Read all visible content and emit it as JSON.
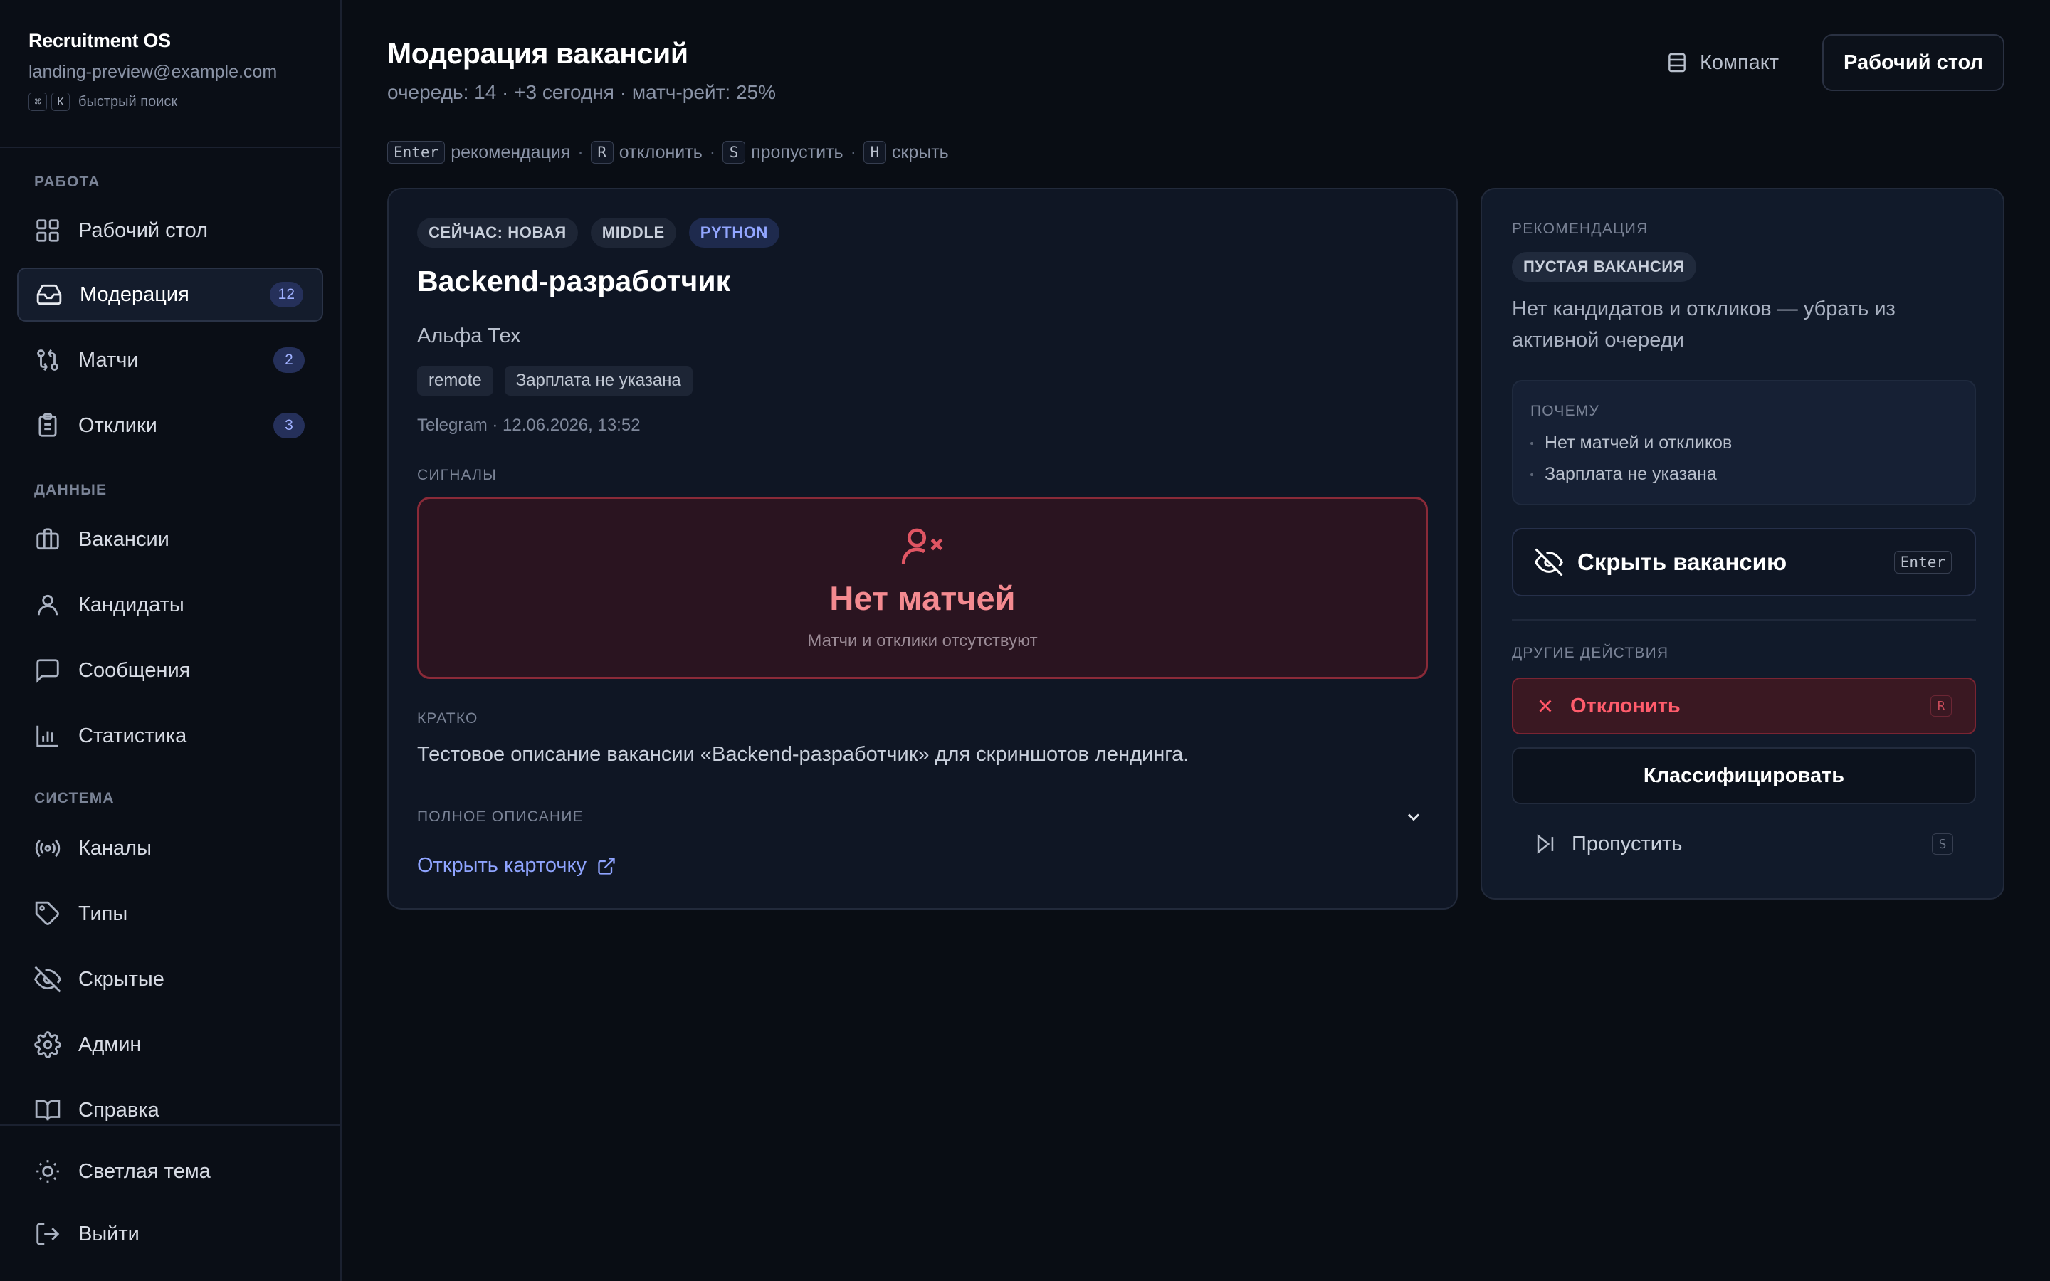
{
  "app": {
    "name": "Recruitment OS",
    "email": "landing-preview@example.com",
    "search_keys": [
      "⌘",
      "K"
    ],
    "search_hint": "быстрый поиск"
  },
  "sidebar": {
    "sections": {
      "work": "РАБОТА",
      "data": "ДАННЫЕ",
      "system": "СИСТЕМА"
    },
    "items": [
      {
        "label": "Рабочий стол",
        "icon": "grid-icon"
      },
      {
        "label": "Модерация",
        "icon": "inbox-icon",
        "badge": "12",
        "active": true
      },
      {
        "label": "Матчи",
        "icon": "git-compare-icon",
        "badge": "2"
      },
      {
        "label": "Отклики",
        "icon": "clipboard-icon",
        "badge": "3"
      },
      {
        "label": "Вакансии",
        "icon": "briefcase-icon"
      },
      {
        "label": "Кандидаты",
        "icon": "user-icon"
      },
      {
        "label": "Сообщения",
        "icon": "message-icon"
      },
      {
        "label": "Статистика",
        "icon": "bar-chart-icon"
      },
      {
        "label": "Каналы",
        "icon": "radio-icon"
      },
      {
        "label": "Типы",
        "icon": "tag-icon"
      },
      {
        "label": "Скрытые",
        "icon": "eye-off-icon"
      },
      {
        "label": "Админ",
        "icon": "gear-icon"
      },
      {
        "label": "Справка",
        "icon": "book-icon"
      }
    ],
    "footer": {
      "theme": "Светлая тема",
      "logout": "Выйти"
    }
  },
  "header": {
    "title": "Модерация вакансий",
    "stats": "очередь: 14 · +3 сегодня · матч-рейт: 25%",
    "compact_label": "Компакт",
    "desk_label": "Рабочий стол"
  },
  "shortcuts": [
    {
      "key": "Enter",
      "label": "рекомендация"
    },
    {
      "key": "R",
      "label": "отклонить"
    },
    {
      "key": "S",
      "label": "пропустить"
    },
    {
      "key": "H",
      "label": "скрыть"
    }
  ],
  "vacancy": {
    "chips": [
      "СЕЙЧАС: НОВАЯ",
      "MIDDLE",
      "PYTHON"
    ],
    "title": "Backend-разработчик",
    "company": "Альфа Тех",
    "tags": [
      "remote",
      "Зарплата не указана"
    ],
    "source": "Telegram · 12.06.2026, 13:52",
    "signals_label": "СИГНАЛЫ",
    "signal": {
      "title": "Нет матчей",
      "subtitle": "Матчи и отклики отсутствуют"
    },
    "brief_label": "КРАТКО",
    "brief": "Тестовое описание вакансии «Backend-разработчик» для скриншотов лендинга.",
    "full_desc_label": "ПОЛНОЕ ОПИСАНИЕ",
    "open_link": "Открыть карточку"
  },
  "recommendation": {
    "label": "РЕКОМЕНДАЦИЯ",
    "chip": "ПУСТАЯ ВАКАНСИЯ",
    "text": "Нет кандидатов и откликов — убрать из активной очереди",
    "why_label": "ПОЧЕМУ",
    "why": [
      "Нет матчей и откликов",
      "Зарплата не указана"
    ],
    "primary": {
      "label": "Скрыть вакансию",
      "key": "Enter"
    },
    "other_label": "ДРУГИЕ ДЕЙСТВИЯ",
    "reject": {
      "label": "Отклонить",
      "key": "R"
    },
    "classify": {
      "label": "Классифицировать"
    },
    "skip": {
      "label": "Пропустить",
      "key": "S"
    }
  },
  "colors": {
    "background": "#090d14",
    "accent": "#8fa4ff",
    "danger": "#ff5c6c",
    "signal_bg": "#2a1420"
  }
}
